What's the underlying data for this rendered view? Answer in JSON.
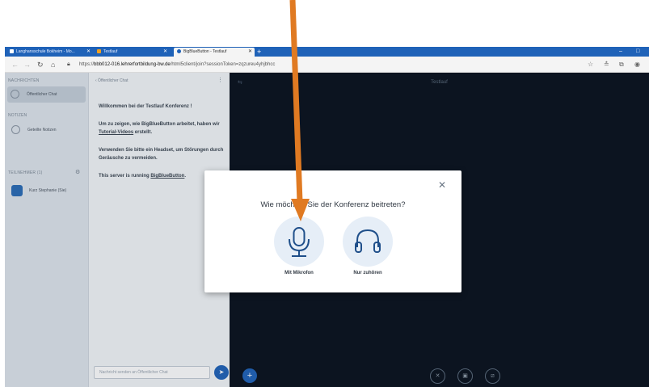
{
  "browser": {
    "tabs": [
      {
        "label": "Langhansschule Bokheim - Mo...",
        "active": false
      },
      {
        "label": "Testlauf",
        "active": false
      },
      {
        "label": "BigBlueButton - Testlauf",
        "active": true
      }
    ],
    "new_tab": "+",
    "url_prefix": "https://",
    "url_host": "bbb012-016.lehrerfortbildung-bw.de",
    "url_path": "/html5client/join?sessionToken=zqzureu4yhjbhcc",
    "colors": {
      "tabbar": "#1f62b8",
      "accent": "#1f62b8"
    }
  },
  "sidebar": {
    "messages_heading": "NACHRICHTEN",
    "public_chat": "Öffentlicher Chat",
    "notes_heading": "NOTIZEN",
    "shared_notes": "Geteilte Notizen",
    "users_heading": "TEILNEHMER (1)",
    "user_name": "Kurz Stephanie (Sie)"
  },
  "chat": {
    "header": "‹ Öffentlicher Chat",
    "menu_icon": "⋮",
    "welcome_prefix": "Willkommen bei der ",
    "welcome_name": "Testlauf",
    "welcome_suffix": " Konferenz !",
    "tutorial_prefix": "Um zu zeigen, wie BigBlueButton arbeitet, haben wir ",
    "tutorial_link": "Tutorial-Videos",
    "tutorial_suffix": " erstellt.",
    "headset_text": "Verwenden Sie bitte ein Headset, um Störungen durch Geräusche zu vermeiden.",
    "server_prefix": "This server is running ",
    "server_link": "BigBlueButton",
    "server_suffix": ".",
    "input_placeholder": "Nachricht senden an Öffentlicher Chat"
  },
  "presentation": {
    "title": "Testlauf"
  },
  "modal": {
    "title": "Wie möchten Sie der Konferenz beitreten?",
    "close_icon": "close-icon",
    "options": [
      {
        "label": "Mit Mikrofon",
        "icon": "microphone-icon"
      },
      {
        "label": "Nur zuhören",
        "icon": "headphones-icon"
      }
    ]
  },
  "annotation": {
    "arrow_color": "#e07a22"
  }
}
